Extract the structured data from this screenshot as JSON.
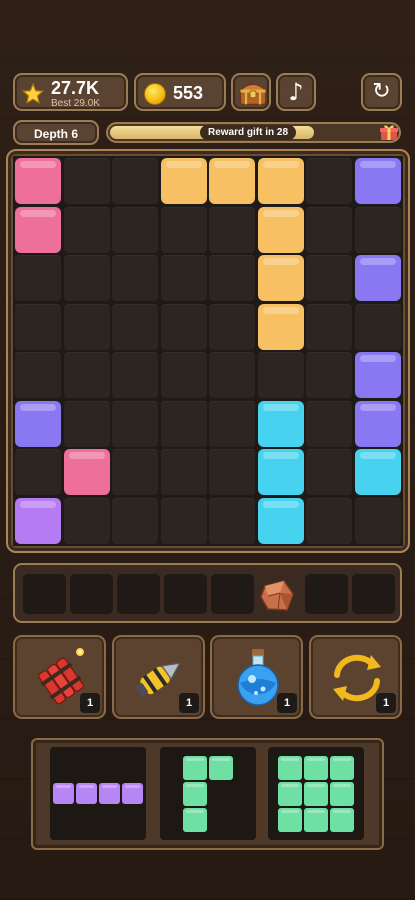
{
  "header": {
    "score": "27.7K",
    "best": "Best 29.0K",
    "coins": "553",
    "icons": {
      "score": "star-icon",
      "coins": "coin-icon",
      "chest": "treasure-chest-icon",
      "music": "music-note-icon",
      "restart": "restart-icon"
    }
  },
  "progress": {
    "depth_label": "Depth 6",
    "reward_label": "Reward gift in 28",
    "fill_fraction": 0.71,
    "gift_icon": "gift-icon"
  },
  "colors": {
    "pink": "#ef6f9b",
    "orange": "#f6c063",
    "purple": "#8a78f2",
    "cyan": "#47d3ef",
    "violet": "#b47bf3",
    "green": "#6fe0a3",
    "piece_purple": "#b786f5"
  },
  "board": {
    "rows": 8,
    "cols": 8,
    "blocks": [
      {
        "r": 0,
        "c": 0,
        "color": "pink"
      },
      {
        "r": 1,
        "c": 0,
        "color": "pink"
      },
      {
        "r": 0,
        "c": 3,
        "color": "orange"
      },
      {
        "r": 0,
        "c": 4,
        "color": "orange"
      },
      {
        "r": 0,
        "c": 5,
        "color": "orange"
      },
      {
        "r": 1,
        "c": 5,
        "color": "orange"
      },
      {
        "r": 2,
        "c": 5,
        "color": "orange"
      },
      {
        "r": 3,
        "c": 5,
        "color": "orange"
      },
      {
        "r": 0,
        "c": 7,
        "color": "purple"
      },
      {
        "r": 2,
        "c": 7,
        "color": "purple"
      },
      {
        "r": 4,
        "c": 7,
        "color": "purple"
      },
      {
        "r": 5,
        "c": 7,
        "color": "purple"
      },
      {
        "r": 5,
        "c": 0,
        "color": "purple"
      },
      {
        "r": 6,
        "c": 1,
        "color": "pink"
      },
      {
        "r": 5,
        "c": 5,
        "color": "cyan"
      },
      {
        "r": 6,
        "c": 5,
        "color": "cyan"
      },
      {
        "r": 7,
        "c": 5,
        "color": "cyan"
      },
      {
        "r": 6,
        "c": 7,
        "color": "cyan"
      },
      {
        "r": 7,
        "c": 0,
        "color": "violet"
      }
    ]
  },
  "tray": {
    "slots": 8,
    "ore_slot": 5,
    "ore_icon": "copper-ore-icon"
  },
  "powerups": [
    {
      "name": "dynamite",
      "icon": "dynamite-icon",
      "count": "1"
    },
    {
      "name": "drill",
      "icon": "drill-icon",
      "count": "1"
    },
    {
      "name": "potion",
      "icon": "potion-icon",
      "count": "1"
    },
    {
      "name": "shuffle",
      "icon": "shuffle-arrows-icon",
      "count": "1"
    }
  ],
  "pieces": [
    {
      "name": "horizontal-4",
      "color": "piece_purple",
      "cells": [
        [
          0,
          0
        ],
        [
          0,
          1
        ],
        [
          0,
          2
        ],
        [
          0,
          3
        ]
      ]
    },
    {
      "name": "l-shape",
      "color": "green",
      "cells": [
        [
          0,
          0
        ],
        [
          0,
          1
        ],
        [
          1,
          0
        ],
        [
          2,
          0
        ]
      ]
    },
    {
      "name": "square-3x3",
      "color": "green",
      "cells": [
        [
          0,
          0
        ],
        [
          0,
          1
        ],
        [
          0,
          2
        ],
        [
          1,
          0
        ],
        [
          1,
          1
        ],
        [
          1,
          2
        ],
        [
          2,
          0
        ],
        [
          2,
          1
        ],
        [
          2,
          2
        ]
      ]
    }
  ]
}
